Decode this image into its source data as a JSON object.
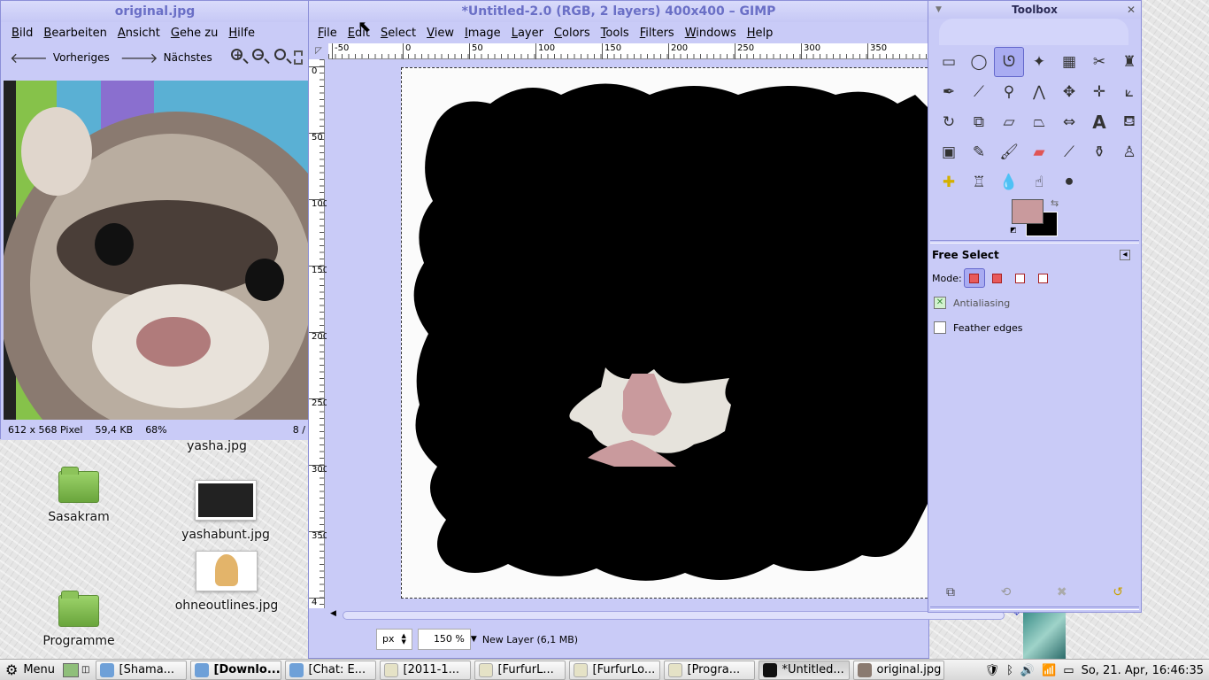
{
  "viewer": {
    "title": "original.jpg",
    "menu": [
      "Bild",
      "Bearbeiten",
      "Ansicht",
      "Gehe zu",
      "Hilfe"
    ],
    "prev_label": "Vorheriges",
    "next_label": "Nächstes",
    "status_dims": "612 x 568 Pixel",
    "status_size": "59,4 KB",
    "status_zoom": "68%",
    "status_index": "8 /"
  },
  "desktop": {
    "icons": [
      {
        "label": "yasha.jpg"
      },
      {
        "label": "Sasakram"
      },
      {
        "label": "yashabunt.jpg"
      },
      {
        "label": "ohneoutlines.jpg"
      },
      {
        "label": "Programme"
      }
    ]
  },
  "gimp": {
    "title": "*Untitled-2.0 (RGB, 2 layers) 400x400 – GIMP",
    "menu": [
      "File",
      "Edit",
      "Select",
      "View",
      "Image",
      "Layer",
      "Colors",
      "Tools",
      "Filters",
      "Windows",
      "Help"
    ],
    "hruler_labels": [
      "-50",
      "0",
      "50",
      "100",
      "150",
      "200",
      "250",
      "300",
      "350"
    ],
    "vruler_labels": [
      "0",
      "50",
      "100",
      "150",
      "200",
      "250",
      "300",
      "350",
      "4"
    ],
    "unit": "px",
    "zoom": "150 %",
    "layer_status": "New Layer (6,1 MB)"
  },
  "toolbox": {
    "title": "Toolbox",
    "options_title": "Free Select",
    "mode_label": "Mode:",
    "antialiasing_label": "Antialiasing",
    "feather_label": "Feather edges",
    "fg_color": "#c99a9d",
    "bg_color": "#000000"
  },
  "taskbar": {
    "menu_label": "Menu",
    "tasks": [
      "[Shama...",
      "[Downlo...",
      "[Chat: E...",
      "[2011-1...",
      "[FurfurL...",
      "[FurfurLo...",
      "[Progra...",
      "*Untitled...",
      "original.jpg"
    ],
    "clock": "So, 21. Apr, 16:46:35"
  }
}
